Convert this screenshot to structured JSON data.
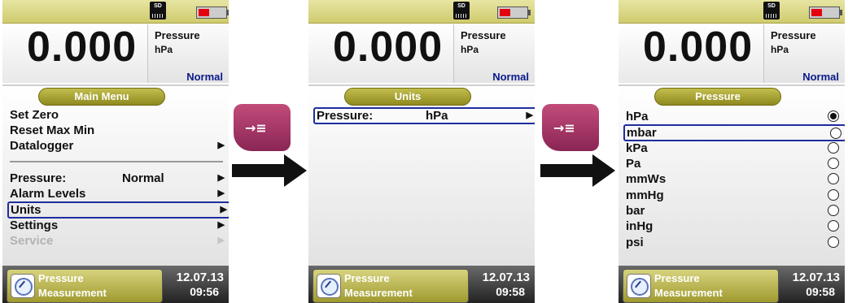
{
  "screens": [
    {
      "value": "0.000",
      "label": "Pressure",
      "unit": "hPa",
      "mode": "Normal",
      "sd": "SD",
      "menu_title": "Main Menu",
      "items": [
        {
          "label": "Set Zero",
          "value": ""
        },
        {
          "label": "Reset Max Min",
          "value": ""
        },
        {
          "label": "Datalogger",
          "value": ""
        },
        {
          "label": "Pressure:",
          "value": "Normal"
        },
        {
          "label": "Alarm Levels",
          "value": ""
        },
        {
          "label": "Units",
          "value": ""
        },
        {
          "label": "Settings",
          "value": ""
        },
        {
          "label": "Service",
          "value": ""
        }
      ],
      "selected": "Units",
      "status_line1": "Pressure",
      "status_line2": "Measurement",
      "date": "12.07.13",
      "time": "09:56"
    },
    {
      "value": "0.000",
      "label": "Pressure",
      "unit": "hPa",
      "mode": "Normal",
      "sd": "SD",
      "menu_title": "Units",
      "items": [
        {
          "label": "Pressure:",
          "value": "hPa"
        }
      ],
      "selected": "Pressure:",
      "status_line1": "Pressure",
      "status_line2": "Measurement",
      "date": "12.07.13",
      "time": "09:58"
    },
    {
      "value": "0.000",
      "label": "Pressure",
      "unit": "hPa",
      "mode": "Normal",
      "sd": "SD",
      "menu_title": "Pressure",
      "options": [
        "hPa",
        "mbar",
        "kPa",
        "Pa",
        "mmWs",
        "mmHg",
        "bar",
        "inHg",
        "psi"
      ],
      "checked": "hPa",
      "selected": "mbar",
      "status_line1": "Pressure",
      "status_line2": "Measurement",
      "date": "12.07.13",
      "time": "09:58"
    }
  ],
  "key_glyph": "→≡",
  "colors": {
    "header_olive": "#cfcb6d",
    "pill_olive": "#8f8a1e",
    "selection_blue": "#1f2d9d",
    "normal_blue": "#0a1a8a",
    "key_magenta": "#a8346a",
    "battery_red": "#e3000f"
  },
  "icons": {
    "sd": "sd-card-icon",
    "battery": "battery-icon",
    "mode": "pressure-gauge-icon",
    "submenu": "submenu-arrow-icon",
    "key": "enter-key-icon",
    "flow": "flow-arrow-icon"
  }
}
